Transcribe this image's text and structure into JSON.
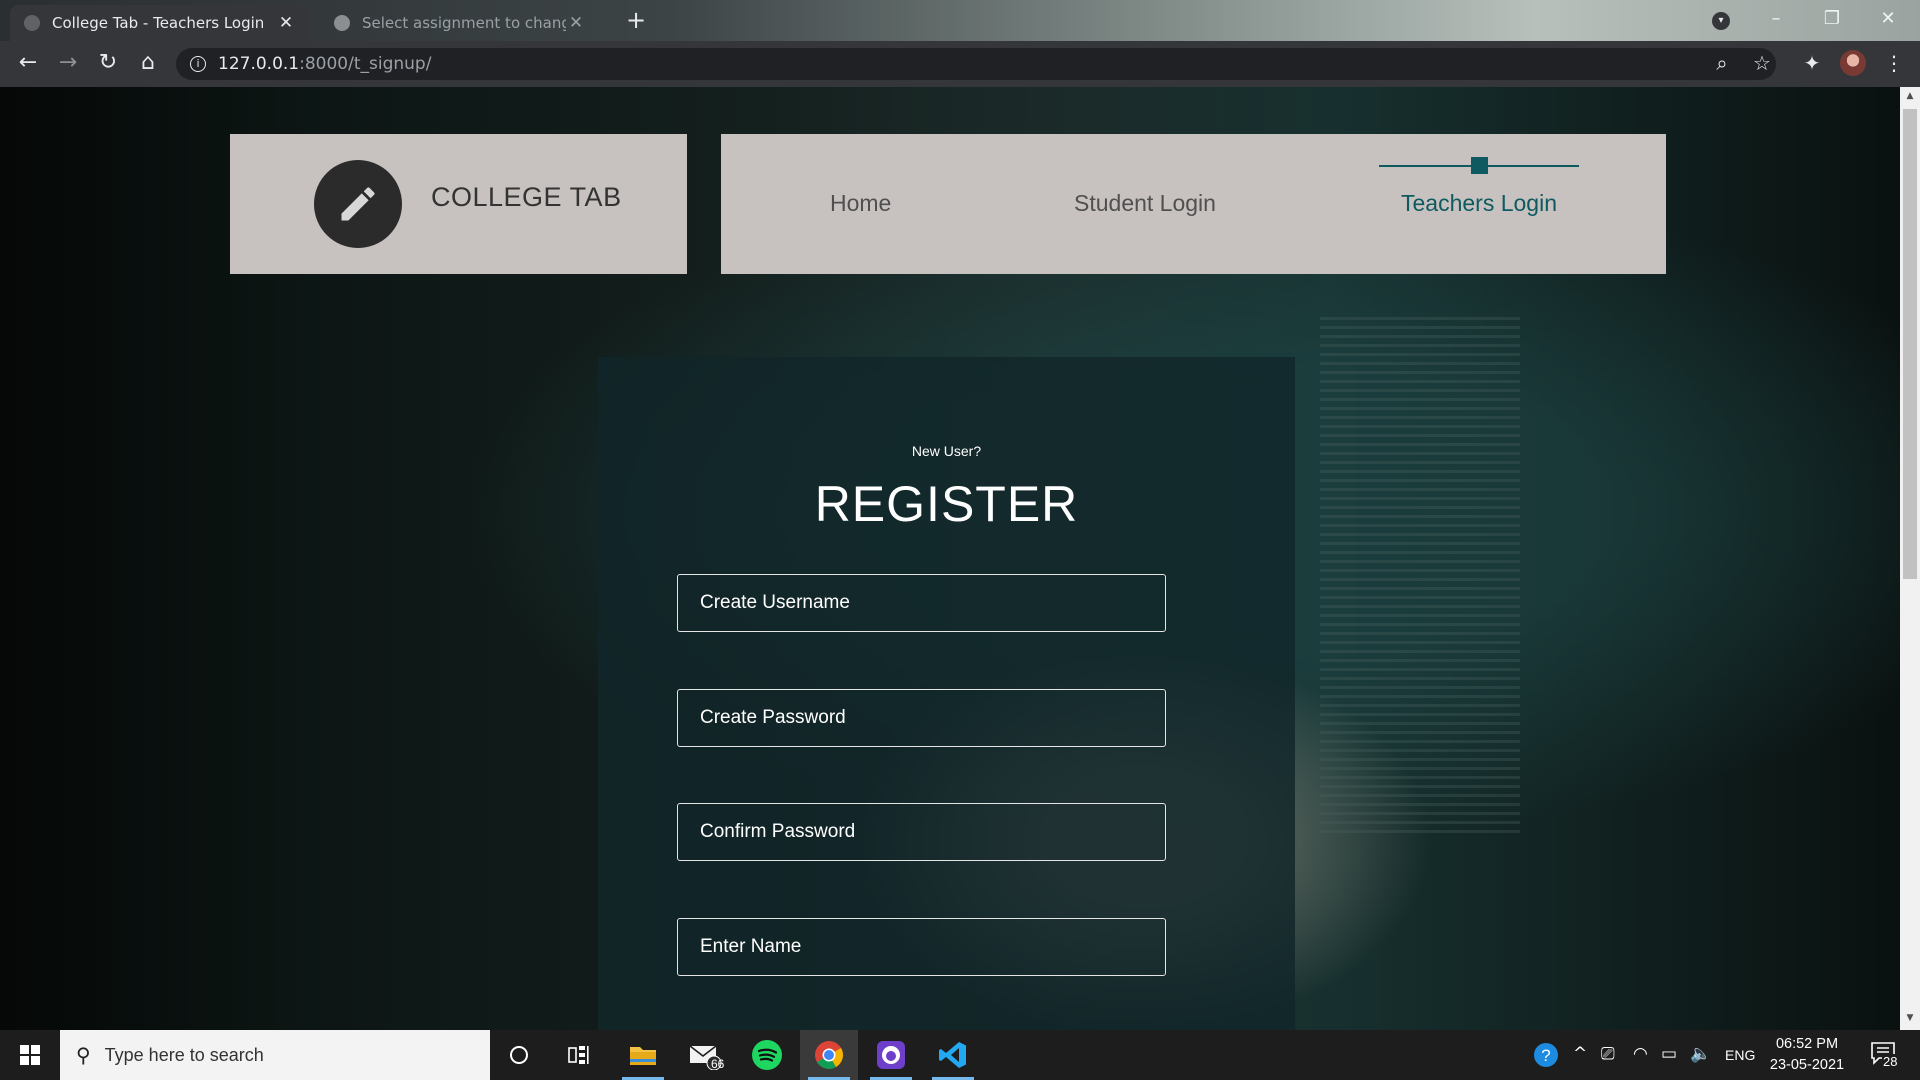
{
  "browser": {
    "active_tab_title": "College Tab - Teachers Login",
    "inactive_tab_title": "Select assignment to change | D",
    "url_host": "127.0.0.1",
    "url_rest": ":8000/t_signup/"
  },
  "header": {
    "brand": "COLLEGE TAB",
    "nav": {
      "home": "Home",
      "student_login": "Student Login",
      "teachers_login": "Teachers Login"
    }
  },
  "form": {
    "subtitle": "New User?",
    "title": "REGISTER",
    "fields": {
      "username": "Create Username",
      "password": "Create Password",
      "confirm": "Confirm Password",
      "name": "Enter Name"
    }
  },
  "taskbar": {
    "search_placeholder": "Type here to search",
    "mail_badge": "66",
    "language": "ENG",
    "time": "06:52 PM",
    "date": "23-05-2021",
    "notification_count": "28"
  },
  "colors": {
    "accent": "#0e5a60",
    "header_bg": "#c7c2bf",
    "panel_bg": "#11262a"
  }
}
